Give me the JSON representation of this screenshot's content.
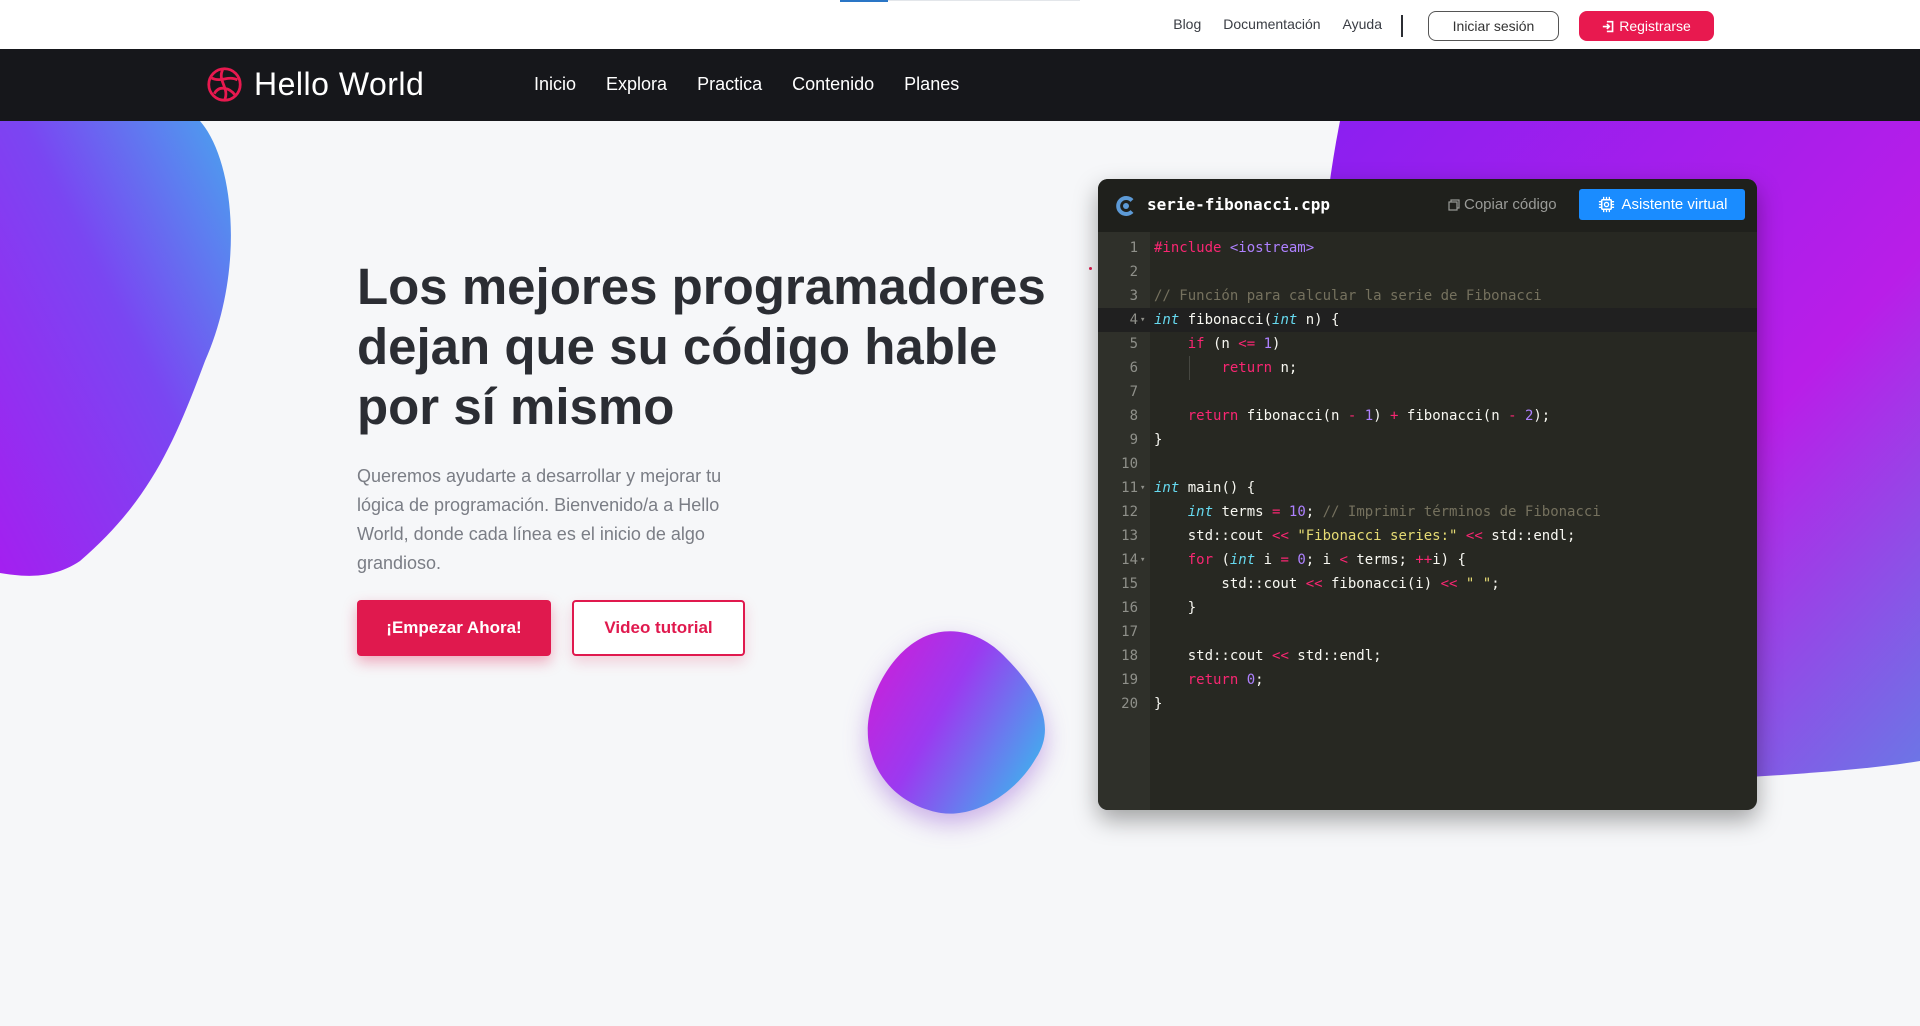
{
  "topbar": {
    "links": [
      "Blog",
      "Documentación",
      "Ayuda"
    ],
    "login_label": "Iniciar sesión",
    "register_label": "Registrarse"
  },
  "navbar": {
    "brand": "Hello World",
    "links": [
      "Inicio",
      "Explora",
      "Practica",
      "Contenido",
      "Planes"
    ]
  },
  "hero": {
    "title_lines": [
      "Los mejores programadores",
      "dejan que su código hable",
      "por sí mismo"
    ],
    "subtitle": "Queremos ayudarte a desarrollar y mejorar tu lógica de programación. Bienvenido/a a Hello World, donde cada línea es el inicio de algo grandioso.",
    "cta_start": "¡Empezar Ahora!",
    "cta_video": "Video tutorial"
  },
  "editor": {
    "file_name": "serie-fibonacci.cpp",
    "copy_label": "Copiar código",
    "assistant_label": "Asistente virtual",
    "active_line": 4,
    "lines": [
      "#include <iostream>",
      "",
      "// Función para calcular la serie de Fibonacci",
      "int fibonacci(int n) {",
      "    if (n <= 1)",
      "        return n;",
      "",
      "    return fibonacci(n - 1) + fibonacci(n - 2);",
      "}",
      "",
      "int main() {",
      "    int terms = 10; // Imprimir términos de Fibonacci",
      "    std::cout << \"Fibonacci series:\" << std::endl;",
      "    for (int i = 0; i < terms; ++i) {",
      "        std::cout << fibonacci(i) << \" \";",
      "    }",
      "",
      "    std::cout << std::endl;",
      "    return 0;",
      "}"
    ],
    "fold_lines": [
      4,
      11,
      14
    ]
  },
  "colors": {
    "accent": "#e0194e",
    "nav_bg": "#16171b",
    "assistant_blue": "#1a8cff",
    "editor_bg": "#272822"
  }
}
